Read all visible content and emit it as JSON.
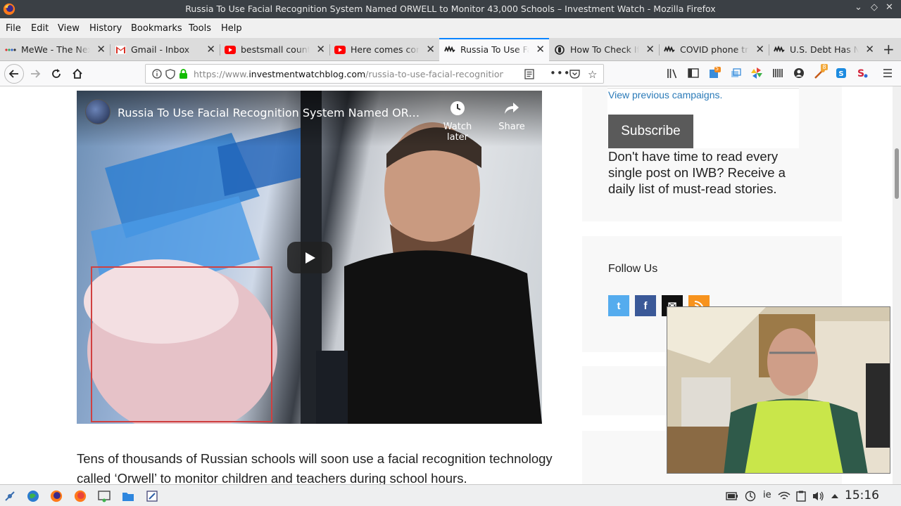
{
  "window": {
    "title": "Russia To Use Facial Recognition System Named ORWELL to Monitor 43,000 Schools – Investment Watch - Mozilla Firefox"
  },
  "menu": [
    "File",
    "Edit",
    "View",
    "History",
    "Bookmarks",
    "Tools",
    "Help"
  ],
  "tabs": [
    {
      "label": "MeWe - The Next",
      "favicon": "mewe-dots-icon",
      "active": false
    },
    {
      "label": "Gmail - Inbox",
      "favicon": "gmail-icon",
      "active": false
    },
    {
      "label": "bestsmall country",
      "favicon": "youtube-icon",
      "active": false
    },
    {
      "label": "Here comes cont",
      "favicon": "youtube-icon",
      "active": false
    },
    {
      "label": "Russia To Use Fac",
      "favicon": "iwb-bull-icon",
      "active": true
    },
    {
      "label": "How To Check If Y",
      "favicon": "globe-shield-icon",
      "active": false
    },
    {
      "label": "COVID phone tra",
      "favicon": "iwb-bull-icon",
      "active": false
    },
    {
      "label": "U.S. Debt Has No",
      "favicon": "iwb-bull-icon",
      "active": false
    }
  ],
  "url": {
    "prefix": "https://www.",
    "domain": "investmentwatchblog.com",
    "path": "/russia-to-use-facial-recognition-system-named-orwell"
  },
  "video": {
    "title": "Russia To Use Facial Recognition System Named ORWEL...",
    "watch_later": "Watch later",
    "share": "Share"
  },
  "article": {
    "text": "Tens of thousands of Russian schools will soon use a facial recognition technology called ‘Orwell’ to monitor children and teachers during school hours."
  },
  "sidebar": {
    "previous_campaigns": "View previous campaigns.",
    "subscribe_label": "Subscribe",
    "subscribe_note": "Don't have time to read every single post on IWB? Receive a daily list of must-read stories.",
    "follow_title": "Follow Us",
    "social": [
      {
        "name": "twitter",
        "glyph": "t",
        "color": "#55acee"
      },
      {
        "name": "facebook",
        "glyph": "f",
        "color": "#3b5998"
      },
      {
        "name": "email",
        "glyph": "✉",
        "color": "#111111"
      },
      {
        "name": "rss",
        "glyph": "",
        "color": "#f7931e"
      }
    ]
  },
  "toolbar_badges": {
    "ext1": "5",
    "ext2": "8"
  },
  "taskbar": {
    "language": "ie",
    "clock": "15:16"
  },
  "colors": {
    "accent": "#0a84ff",
    "link": "#2a7ab8",
    "titlebar": "#3b4045"
  }
}
